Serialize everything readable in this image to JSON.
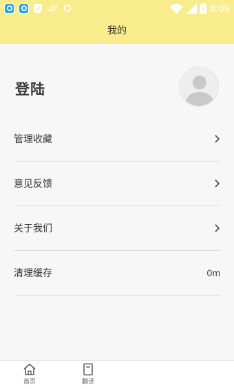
{
  "status_bar": {
    "time": "8:09",
    "icons": [
      "app-icon",
      "app-icon",
      "shield-icon",
      "check-icon",
      "sync-icon",
      "wifi-icon",
      "signal-icon",
      "battery-charging-icon"
    ]
  },
  "header": {
    "title": "我的",
    "background": "#f9ec8c"
  },
  "profile": {
    "login_label": "登陆",
    "avatar_icon": "user-avatar-icon"
  },
  "menu": {
    "items": [
      {
        "label": "管理收藏",
        "icon": "chevron-right-icon"
      },
      {
        "label": "意见反馈",
        "icon": "chevron-right-icon"
      },
      {
        "label": "关于我们",
        "icon": "chevron-right-icon"
      },
      {
        "label": "清理缓存",
        "value": "0m"
      }
    ]
  },
  "tabbar": {
    "tabs": [
      {
        "label": "首页",
        "icon": "home-icon"
      },
      {
        "label": "翻译",
        "icon": "book-icon"
      }
    ]
  }
}
